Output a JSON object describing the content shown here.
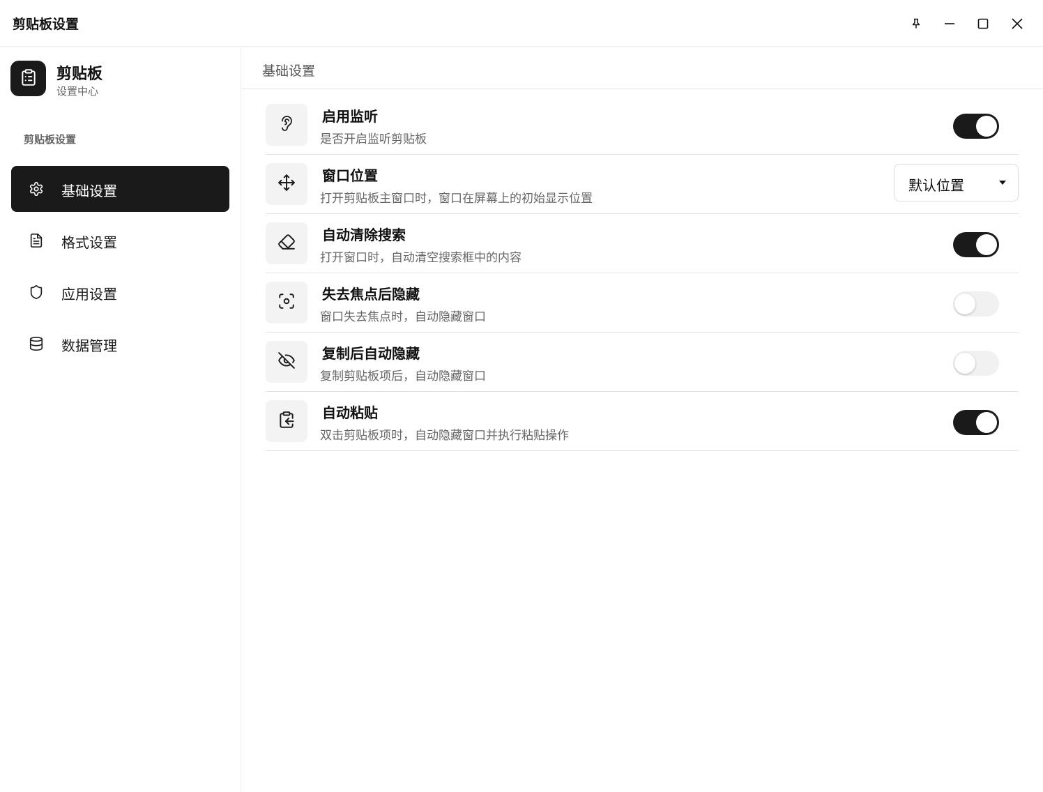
{
  "window": {
    "title": "剪贴板设置"
  },
  "sidebar": {
    "brand_name": "剪贴板",
    "brand_subtitle": "设置中心",
    "section_label": "剪贴板设置",
    "items": [
      {
        "label": "基础设置",
        "icon": "gear-icon",
        "active": true
      },
      {
        "label": "格式设置",
        "icon": "document-icon",
        "active": false
      },
      {
        "label": "应用设置",
        "icon": "shield-icon",
        "active": false
      },
      {
        "label": "数据管理",
        "icon": "database-icon",
        "active": false
      }
    ]
  },
  "main": {
    "breadcrumb": "基础设置",
    "settings": [
      {
        "title": "启用监听",
        "description": "是否开启监听剪贴板",
        "icon": "ear-icon",
        "control": "toggle",
        "enabled": true
      },
      {
        "title": "窗口位置",
        "description": "打开剪贴板主窗口时，窗口在屏幕上的初始显示位置",
        "icon": "move-icon",
        "control": "select",
        "value": "默认位置"
      },
      {
        "title": "自动清除搜索",
        "description": "打开窗口时，自动清空搜索框中的内容",
        "icon": "eraser-icon",
        "control": "toggle",
        "enabled": true
      },
      {
        "title": "失去焦点后隐藏",
        "description": "窗口失去焦点时，自动隐藏窗口",
        "icon": "focus-icon",
        "control": "toggle",
        "enabled": false
      },
      {
        "title": "复制后自动隐藏",
        "description": "复制剪贴板项后，自动隐藏窗口",
        "icon": "eye-off-icon",
        "control": "toggle",
        "enabled": false
      },
      {
        "title": "自动粘贴",
        "description": "双击剪贴板项时，自动隐藏窗口并执行粘贴操作",
        "icon": "clipboard-paste-icon",
        "control": "toggle",
        "enabled": true
      }
    ]
  },
  "colors": {
    "accent": "#1a1a1a",
    "toggle_off": "#f1f1f1",
    "divider": "#e3e3e3"
  }
}
